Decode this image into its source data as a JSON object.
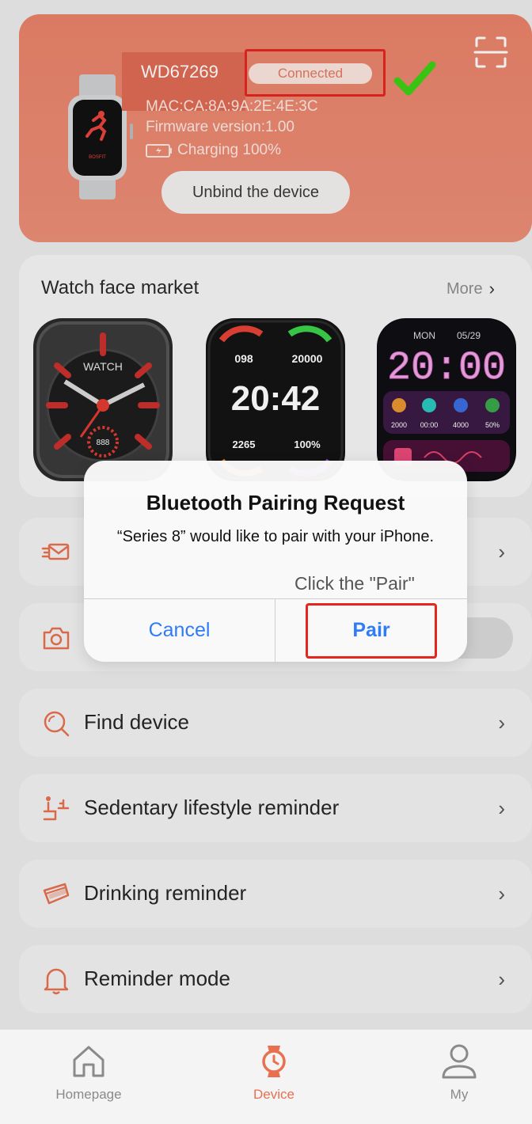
{
  "device": {
    "name": "WD67269",
    "status": "Connected",
    "mac": "MAC:CA:8A:9A:2E:4E:3C",
    "firmware": "Firmware version:1.00",
    "charging": "Charging 100%",
    "unbind_label": "Unbind the device",
    "watch_brand": "BOSFIT"
  },
  "market": {
    "title": "Watch face market",
    "more_label": "More",
    "faces": [
      {
        "label": "WATCH",
        "dial_value": "888"
      },
      {
        "time": "20:42",
        "steps": "20000",
        "heart": "098",
        "cal": "2265",
        "battery": "100%"
      },
      {
        "day": "MON",
        "date": "05/29",
        "time": "20:00",
        "stats": [
          "2000",
          "00:00",
          "4000",
          "50%"
        ]
      }
    ]
  },
  "rows": [
    {
      "label": ""
    },
    {
      "label": ""
    },
    {
      "label": "Find device"
    },
    {
      "label": "Sedentary lifestyle reminder"
    },
    {
      "label": "Drinking reminder"
    },
    {
      "label": "Reminder mode"
    }
  ],
  "alert": {
    "title": "Bluetooth Pairing Request",
    "message": "“Series 8” would like to pair with your iPhone.",
    "hint": "Click the \"Pair\"",
    "cancel_label": "Cancel",
    "pair_label": "Pair"
  },
  "nav": {
    "home_label": "Homepage",
    "device_label": "Device",
    "my_label": "My"
  },
  "colors": {
    "accent": "#e8704f",
    "card": "#e9826a",
    "ios_blue": "#2f7cf6",
    "highlight_red": "#e5261f"
  }
}
